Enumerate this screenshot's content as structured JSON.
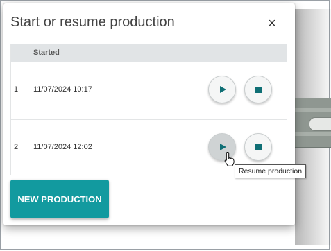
{
  "dialog": {
    "title": "Start or resume production",
    "close_label": "×"
  },
  "table": {
    "columns": [
      "",
      "Started",
      ""
    ],
    "rows": [
      {
        "index": "1",
        "started": "11/07/2024 10:17"
      },
      {
        "index": "2",
        "started": "11/07/2024 12:02"
      }
    ]
  },
  "actions": {
    "new_production_label": "NEW PRODUCTION"
  },
  "tooltip": {
    "text": "Resume production"
  },
  "icons": {
    "play": "play-icon",
    "stop": "stop-icon",
    "close": "close-icon",
    "cursor": "hand-pointer-icon"
  },
  "colors": {
    "accent": "#129a9f",
    "icon": "#0f6f75",
    "header_bg": "#e1e4e6"
  }
}
